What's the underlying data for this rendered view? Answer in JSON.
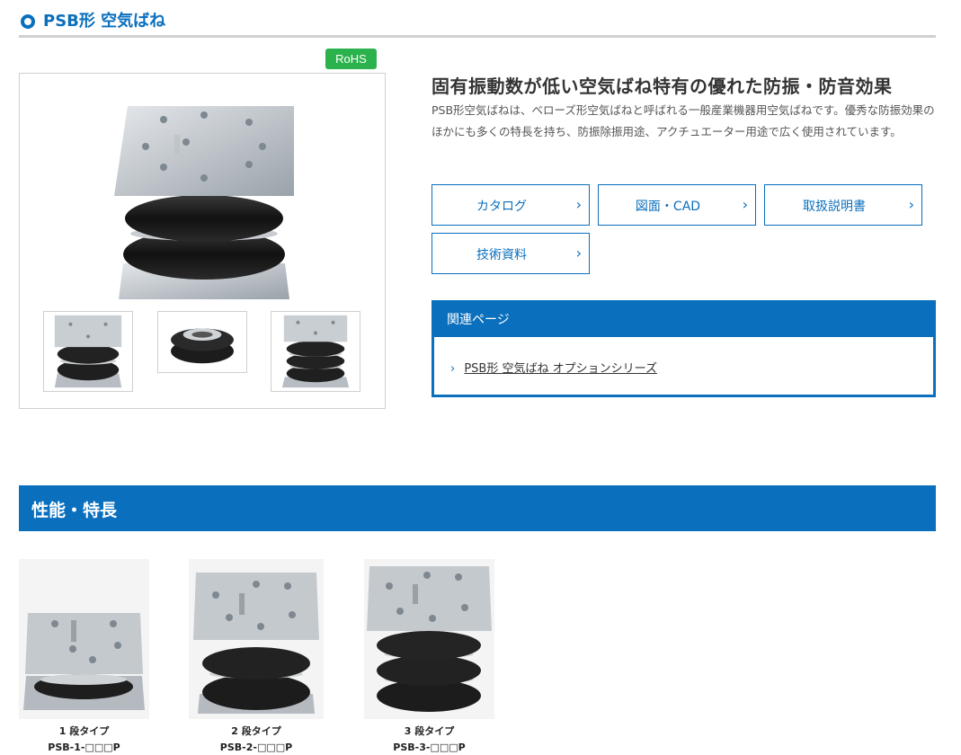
{
  "header": {
    "title": "PSB形 空気ばね"
  },
  "gallery": {
    "badge": "RoHS"
  },
  "product": {
    "headline": "固有振動数が低い空気ばね特有の優れた防振・防音効果",
    "description": "PSB形空気ばねは、ベローズ形空気ばねと呼ばれる一般産業機器用空気ばねです。優秀な防振効果のほかにも多くの特長を持ち、防振除振用途、アクチュエーター用途で広く使用されています。"
  },
  "buttons": [
    {
      "label": "カタログ"
    },
    {
      "label": "図面・CAD"
    },
    {
      "label": "取扱説明書"
    },
    {
      "label": "技術資料"
    }
  ],
  "related": {
    "heading": "関連ページ",
    "link": "PSB形 空気ばね オプションシリーズ"
  },
  "features": {
    "heading": "性能・特長",
    "types": [
      {
        "name": "1 段タイプ",
        "code": "PSB-1-□□□P"
      },
      {
        "name": "2 段タイプ",
        "code": "PSB-2-□□□P"
      },
      {
        "name": "3 段タイプ",
        "code": "PSB-3-□□□P"
      }
    ]
  },
  "colors": {
    "accent": "#0a6fbd",
    "rohs": "#2bb24c"
  }
}
